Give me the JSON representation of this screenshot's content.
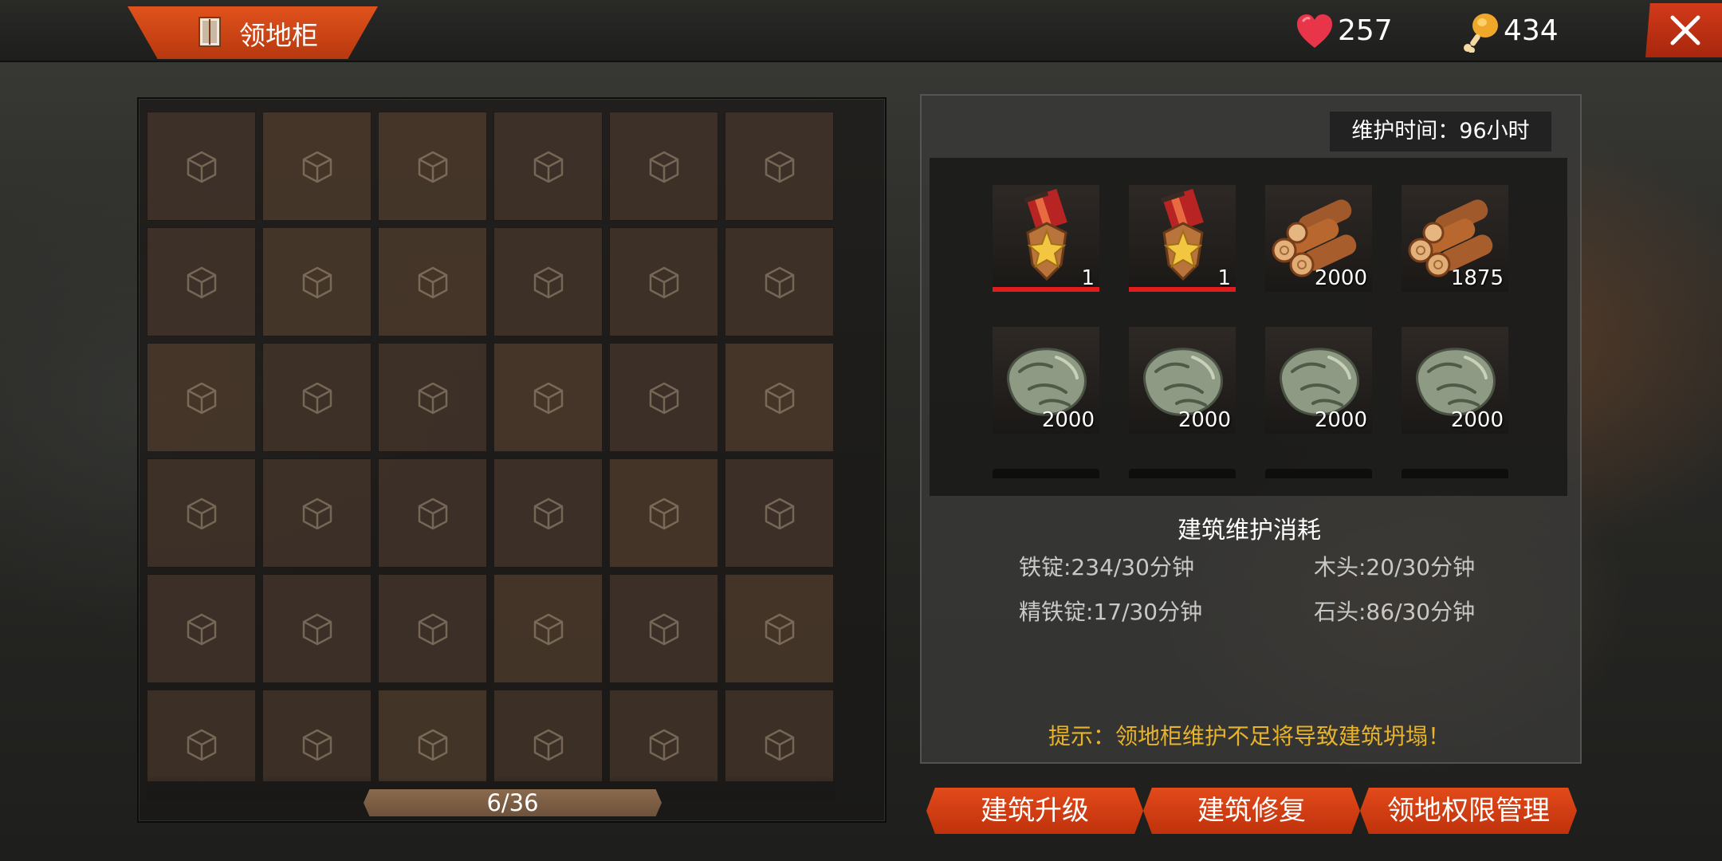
{
  "header": {
    "title": "领地柜",
    "title_icon": "cabinet-icon",
    "hp_value": "257",
    "hp_icon": "heart-icon",
    "food_value": "434",
    "food_icon": "chicken-leg-icon",
    "close_icon": "close-icon"
  },
  "storage": {
    "capacity_label": "6/36",
    "slot_icon": "box-icon",
    "visible_slots": 36
  },
  "maintenance": {
    "time_label": "维护时间：96小时",
    "items": [
      {
        "icon": "medal-icon",
        "count": "1",
        "bar": true
      },
      {
        "icon": "medal-icon",
        "count": "1",
        "bar": true
      },
      {
        "icon": "wood-logs-icon",
        "count": "2000",
        "bar": false
      },
      {
        "icon": "wood-logs-icon",
        "count": "1875",
        "bar": false
      },
      {
        "icon": "stone-icon",
        "count": "2000",
        "bar": false
      },
      {
        "icon": "stone-icon",
        "count": "2000",
        "bar": false
      },
      {
        "icon": "stone-icon",
        "count": "2000",
        "bar": false
      },
      {
        "icon": "stone-icon",
        "count": "2000",
        "bar": false
      }
    ],
    "section_title": "建筑维护消耗",
    "costs": {
      "iron": "铁锭:234/30分钟",
      "wood": "木头:20/30分钟",
      "refined_iron": "精铁锭:17/30分钟",
      "stone": "石头:86/30分钟"
    },
    "hint": "提示：领地柜维护不足将导致建筑坍塌！"
  },
  "actions": {
    "upgrade": "建筑升级",
    "repair": "建筑修复",
    "permissions": "领地权限管理"
  },
  "colors": {
    "accent_orange": "#d8461a",
    "hint_yellow": "#e8b32c",
    "durability_red": "#e01c1c"
  }
}
